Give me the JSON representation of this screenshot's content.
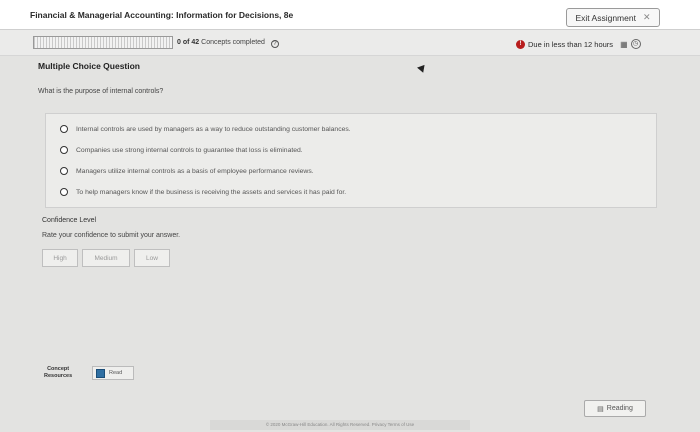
{
  "header": {
    "title": "Financial & Managerial Accounting: Information for Decisions, 8e",
    "exit_label": "Exit Assignment",
    "exit_icon": "close-icon"
  },
  "progress": {
    "concepts_done": "0 of 42",
    "concepts_label": "Concepts completed",
    "fraction_complete": 0.0,
    "due_text": "Due in less than 12 hours"
  },
  "question": {
    "type": "Multiple Choice Question",
    "prompt": "What is the purpose of internal controls?",
    "options": [
      "Internal controls are used by managers as a way to reduce outstanding customer balances.",
      "Companies use strong internal controls to guarantee that loss is eliminated.",
      "Managers utilize internal controls as a basis of employee performance reviews.",
      "To help managers know if the business is receiving the assets and services it has paid for."
    ]
  },
  "confidence": {
    "title": "Confidence Level",
    "subtitle": "Rate your confidence to submit your answer.",
    "buttons": [
      "High",
      "Medium",
      "Low"
    ]
  },
  "resources": {
    "label_line1": "Concept",
    "label_line2": "Resources",
    "read_label": "Read"
  },
  "reading_label": "Reading",
  "footer_text": "© 2020 McGraw-Hill Education. All Rights Reserved.   Privacy   Terms of Use"
}
